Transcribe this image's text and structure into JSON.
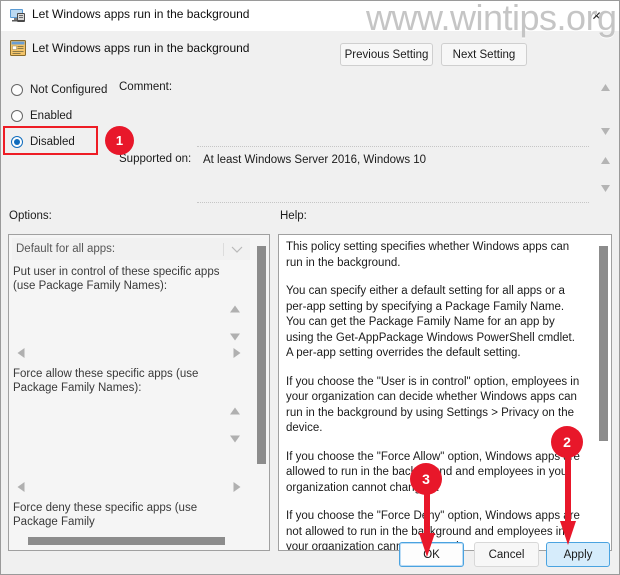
{
  "window": {
    "title": "Let Windows apps run in the background",
    "title_icon": "computer-policy-icon",
    "close_label": "✕"
  },
  "watermark": {
    "text": "www.wintips.org"
  },
  "header": {
    "policy_icon": "policy-setting-icon",
    "policy_name": "Let Windows apps run in the background",
    "previous_setting": "Previous Setting",
    "next_setting": "Next Setting"
  },
  "state": {
    "options": [
      {
        "label": "Not Configured",
        "selected": false
      },
      {
        "label": "Enabled",
        "selected": false
      },
      {
        "label": "Disabled",
        "selected": true
      }
    ]
  },
  "comment": {
    "label": "Comment:",
    "value": ""
  },
  "supported": {
    "label": "Supported on:",
    "value": "At least Windows Server 2016, Windows 10"
  },
  "panels": {
    "options_label": "Options:",
    "help_label": "Help:"
  },
  "options": {
    "default_combo": {
      "label": "Default for all apps:",
      "value": ""
    },
    "put_user_label": "Put user in control of these specific apps (use Package Family Names):",
    "force_allow_label": "Force allow these specific apps (use Package Family Names):",
    "force_deny_label": "Force deny these specific apps (use Package Family"
  },
  "help": {
    "paragraphs": [
      "This policy setting specifies whether Windows apps can run in the background.",
      "You can specify either a default setting for all apps or a per-app setting by specifying a Package Family Name. You can get the Package Family Name for an app by using the Get-AppPackage Windows PowerShell cmdlet. A per-app setting overrides the default setting.",
      "If you choose the \"User is in control\" option, employees in your organization can decide whether Windows apps can run in the background by using Settings > Privacy on the device.",
      "If you choose the \"Force Allow\" option, Windows apps are allowed to run in the background and employees in your organization cannot change it.",
      "If you choose the \"Force Deny\" option, Windows apps are not allowed to run in the background and employees in your organization cannot change it."
    ]
  },
  "buttons": {
    "ok": "OK",
    "cancel": "Cancel",
    "apply": "Apply"
  },
  "annotations": {
    "accent_color": "#e8172a",
    "badges": [
      {
        "number": "1",
        "target": "disabled-radio"
      },
      {
        "number": "2",
        "target": "apply-button"
      },
      {
        "number": "3",
        "target": "ok-button"
      }
    ]
  }
}
